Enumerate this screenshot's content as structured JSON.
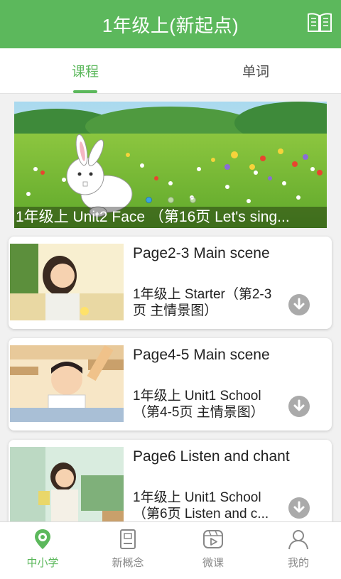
{
  "header": {
    "title": "1年级上(新起点)",
    "icon": "book-icon"
  },
  "tabs": [
    {
      "label": "课程",
      "active": true
    },
    {
      "label": "单词",
      "active": false
    }
  ],
  "banner": {
    "caption": "1年级上 Unit2 Face （第16页 Let's sing...",
    "slides": 3,
    "active_slide": 1
  },
  "lessons": [
    {
      "title": "Page2-3 Main scene",
      "subtitle": "1年级上 Starter（第2-3页 主情景图）",
      "icon": "download-icon"
    },
    {
      "title": "Page4-5 Main scene",
      "subtitle": "1年级上 Unit1 School （第4-5页 主情景图）",
      "icon": "download-icon"
    },
    {
      "title": "Page6 Listen and chant",
      "subtitle": "1年级上 Unit1 School （第6页 Listen and c...",
      "icon": "download-icon"
    }
  ],
  "bottom_nav": [
    {
      "label": "中小学",
      "icon": "location-badge-icon",
      "active": true
    },
    {
      "label": "新概念",
      "icon": "book-icon",
      "active": false
    },
    {
      "label": "微课",
      "icon": "video-icon",
      "active": false
    },
    {
      "label": "我的",
      "icon": "user-icon",
      "active": false
    }
  ],
  "colors": {
    "accent": "#5cb85c"
  }
}
